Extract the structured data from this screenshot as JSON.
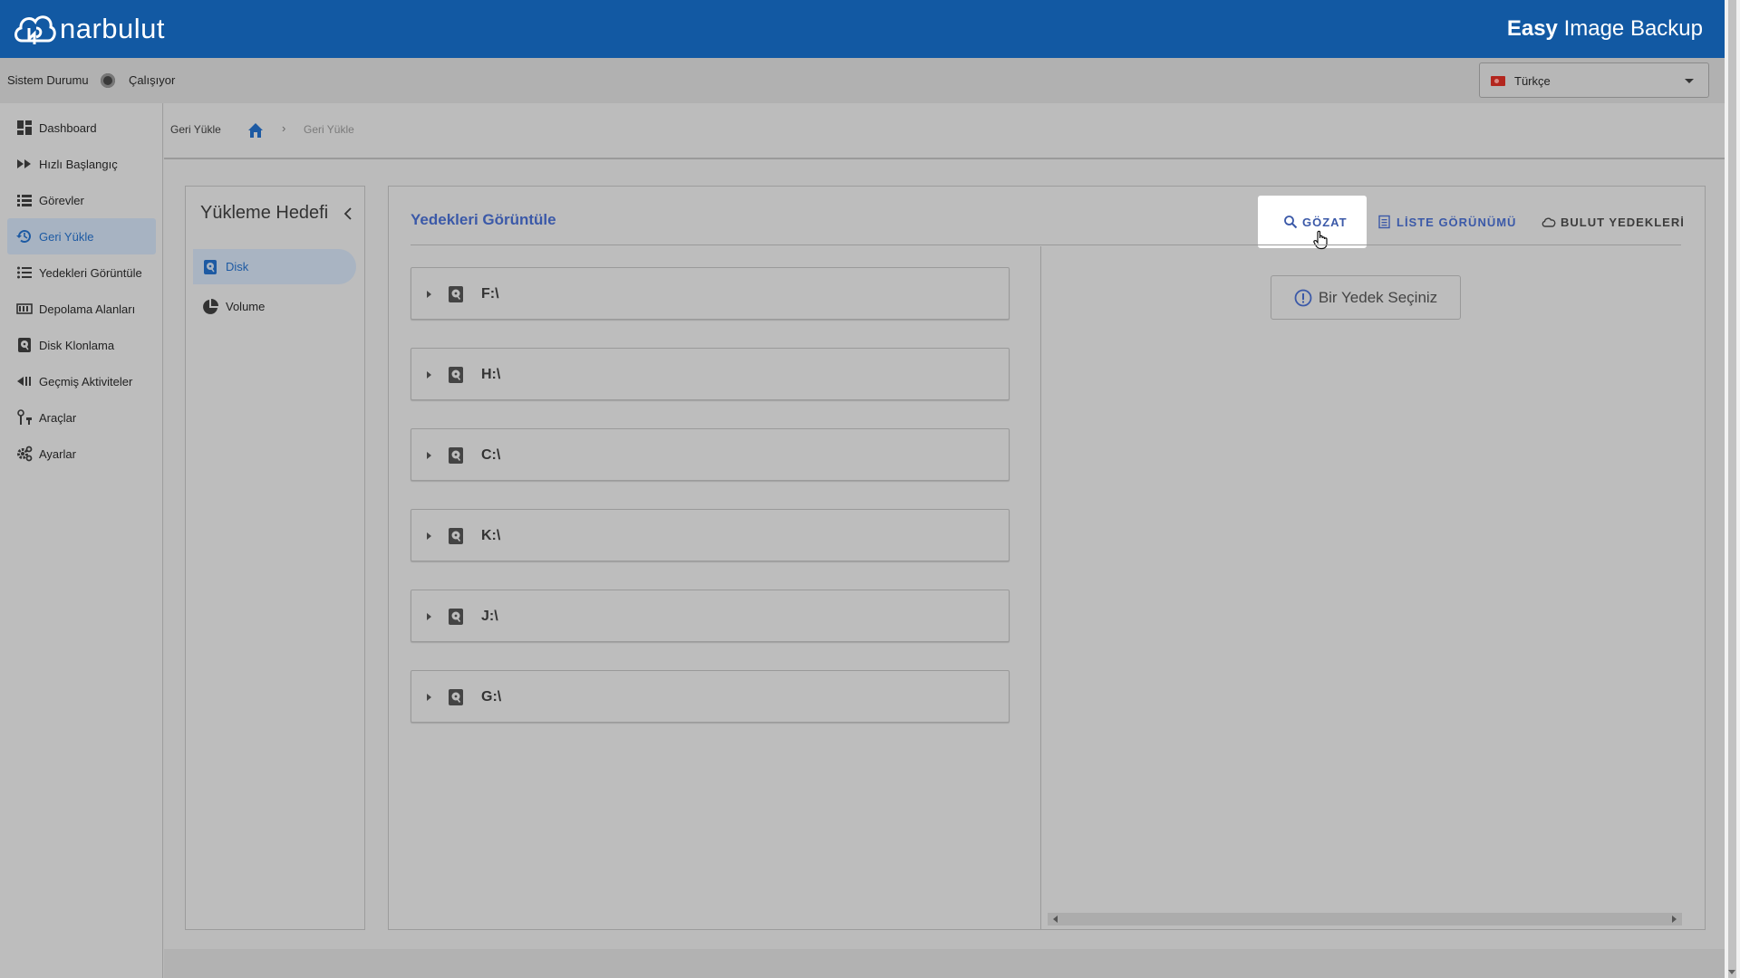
{
  "header": {
    "brand": "narbulut",
    "app_title_bold": "Easy",
    "app_title_rest": " Image Backup"
  },
  "status": {
    "label": "Sistem Durumu",
    "value": "Çalışıyor",
    "language": "Türkçe"
  },
  "sidebar": {
    "items": [
      {
        "label": "Dashboard",
        "icon": "dashboard-icon"
      },
      {
        "label": "Hızlı Başlangıç",
        "icon": "fast-forward-icon"
      },
      {
        "label": "Görevler",
        "icon": "list-icon"
      },
      {
        "label": "Geri Yükle",
        "icon": "restore-icon",
        "active": true
      },
      {
        "label": "Yedekleri Görüntüle",
        "icon": "bullet-list-icon"
      },
      {
        "label": "Depolama Alanları",
        "icon": "storage-icon"
      },
      {
        "label": "Disk Klonlama",
        "icon": "disk-icon"
      },
      {
        "label": "Geçmiş Aktiviteler",
        "icon": "rewind-icon"
      },
      {
        "label": "Araçlar",
        "icon": "tools-icon"
      },
      {
        "label": "Ayarlar",
        "icon": "gear-icon"
      }
    ]
  },
  "breadcrumb": {
    "first": "Geri Yükle",
    "separator": "›",
    "current": "Geri Yükle"
  },
  "target_panel": {
    "title": "Yükleme Hedefi",
    "items": [
      {
        "label": "Disk",
        "active": true
      },
      {
        "label": "Volume"
      }
    ]
  },
  "main": {
    "title": "Yedekleri Görüntüle",
    "tabs": {
      "browse": "GÖZAT",
      "list": "LİSTE GÖRÜNÜMÜ",
      "cloud": "BULUT YEDEKLERİ"
    },
    "drives": [
      "F:\\",
      "H:\\",
      "C:\\",
      "K:\\",
      "J:\\",
      "G:\\"
    ],
    "select_message": "Bir Yedek Seçiniz"
  },
  "colors": {
    "header_bg": "#1259a3",
    "accent": "#3b59a8",
    "active_nav_text": "#1d5aa3"
  }
}
